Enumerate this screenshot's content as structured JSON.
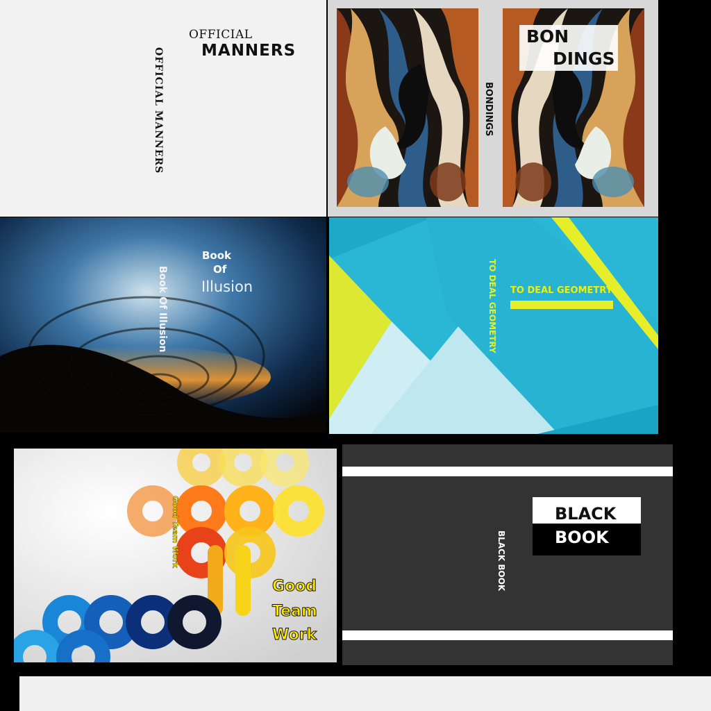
{
  "official_manners": {
    "title_small": "OFFICIAL",
    "title_big": "MANNERS",
    "spine": "OFFICIAL MANNERS"
  },
  "bondings": {
    "label_line1": "BON",
    "label_line2": "DINGS",
    "spine": "BONDINGS"
  },
  "illusion": {
    "line1": "Book",
    "line2": "Of",
    "line3": "Illusion",
    "spine": "Book Of Illusion"
  },
  "geometry": {
    "title": "TO DEAL GEOMETRY",
    "spine": "TO DEAL GEOMETRY"
  },
  "team_work": {
    "line1": "Good",
    "line2": "Team",
    "line3": "Work",
    "spine": "Good Team Work"
  },
  "black_book": {
    "line1": "BLACK",
    "line2": "BOOK",
    "spine": "BLACK BOOK"
  }
}
